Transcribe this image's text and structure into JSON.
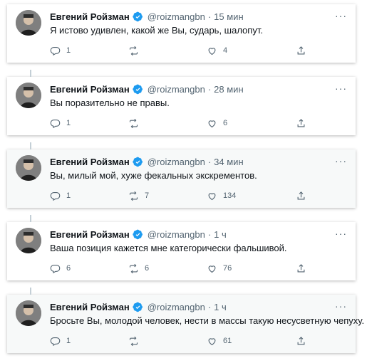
{
  "tweets": [
    {
      "name": "Евгений Ройзман",
      "handle": "@roizmangbn",
      "dot": "·",
      "time": "15 мин",
      "text": "Я истово удивлен, какой же Вы, сударь, шалопут.",
      "reply_count": "1",
      "retweet_count": "",
      "like_count": "4"
    },
    {
      "name": "Евгений Ройзман",
      "handle": "@roizmangbn",
      "dot": "·",
      "time": "28 мин",
      "text": "Вы поразительно не правы.",
      "reply_count": "1",
      "retweet_count": "",
      "like_count": "6"
    },
    {
      "name": "Евгений Ройзман",
      "handle": "@roizmangbn",
      "dot": "·",
      "time": "34 мин",
      "text": "Вы, милый мой, хуже фекальных экскрементов.",
      "reply_count": "1",
      "retweet_count": "7",
      "like_count": "134"
    },
    {
      "name": "Евгений Ройзман",
      "handle": "@roizmangbn",
      "dot": "·",
      "time": "1 ч",
      "text": "Ваша позиция кажется мне категорически фальшивой.",
      "reply_count": "6",
      "retweet_count": "6",
      "like_count": "76"
    },
    {
      "name": "Евгений Ройзман",
      "handle": "@roizmangbn",
      "dot": "·",
      "time": "1 ч",
      "text": "Бросьте Вы, молодой человек, нести в массы такую несусветную чепуху.",
      "reply_count": "1",
      "retweet_count": "",
      "like_count": "61"
    }
  ],
  "icons": {
    "verified": "verified-badge-icon",
    "more": "more-options-icon",
    "reply": "reply-icon",
    "retweet": "retweet-icon",
    "like": "like-icon",
    "share": "share-icon"
  },
  "more_glyph": "···",
  "colors": {
    "verified": "#1d9bf0",
    "secondary_text": "#536471",
    "thread_line": "#c4cfd6"
  }
}
